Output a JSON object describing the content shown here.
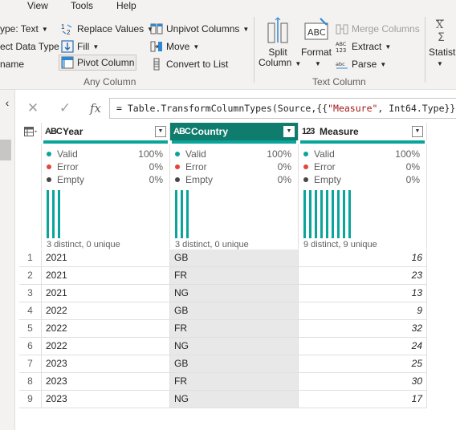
{
  "menu": [
    "View",
    "Tools",
    "Help"
  ],
  "ribbon": {
    "left_items": {
      "data_type": "ype: Text",
      "detect_data_type": "ect Data Type",
      "rename": "name"
    },
    "any_column": {
      "replace_values": "Replace Values",
      "fill": "Fill",
      "pivot_column": "Pivot Column",
      "unpivot_columns": "Unpivot Columns",
      "move": "Move",
      "convert_to_list": "Convert to List",
      "group_label": "Any Column"
    },
    "text_column": {
      "split_column_1": "Split",
      "split_column_2": "Column",
      "format": "Format",
      "merge_columns": "Merge Columns",
      "extract": "Extract",
      "parse": "Parse",
      "group_label": "Text Column"
    },
    "statistics": "Statist"
  },
  "formula": {
    "prefix": "= Table.TransformColumnTypes(Source,{{",
    "string": "\"Measure\"",
    "suffix": ", Int64.Type}})"
  },
  "columns": [
    {
      "type_icon": "ABC",
      "name": "Year",
      "valid_label": "Valid",
      "valid": "100%",
      "error_label": "Error",
      "error": "0%",
      "empty_label": "Empty",
      "empty": "0%",
      "distinct": "3 distinct, 0 unique",
      "bar_count": 3
    },
    {
      "type_icon": "ABC",
      "name": "Country",
      "valid_label": "Valid",
      "valid": "100%",
      "error_label": "Error",
      "error": "0%",
      "empty_label": "Empty",
      "empty": "0%",
      "distinct": "3 distinct, 0 unique",
      "bar_count": 3
    },
    {
      "type_icon": "123",
      "name": "Measure",
      "valid_label": "Valid",
      "valid": "100%",
      "error_label": "Error",
      "error": "0%",
      "empty_label": "Empty",
      "empty": "0%",
      "distinct": "9 distinct, 9 unique",
      "bar_count": 9
    }
  ],
  "rows": [
    {
      "n": "1",
      "year": "2021",
      "country": "GB",
      "measure": "16"
    },
    {
      "n": "2",
      "year": "2021",
      "country": "FR",
      "measure": "23"
    },
    {
      "n": "3",
      "year": "2021",
      "country": "NG",
      "measure": "13"
    },
    {
      "n": "4",
      "year": "2022",
      "country": "GB",
      "measure": "9"
    },
    {
      "n": "5",
      "year": "2022",
      "country": "FR",
      "measure": "32"
    },
    {
      "n": "6",
      "year": "2022",
      "country": "NG",
      "measure": "24"
    },
    {
      "n": "7",
      "year": "2023",
      "country": "GB",
      "measure": "25"
    },
    {
      "n": "8",
      "year": "2023",
      "country": "FR",
      "measure": "30"
    },
    {
      "n": "9",
      "year": "2023",
      "country": "NG",
      "measure": "17"
    }
  ],
  "colors": {
    "valid": "#0aa59a",
    "error": "#e3453a",
    "empty": "#484644",
    "active_header": "#107c6e"
  }
}
